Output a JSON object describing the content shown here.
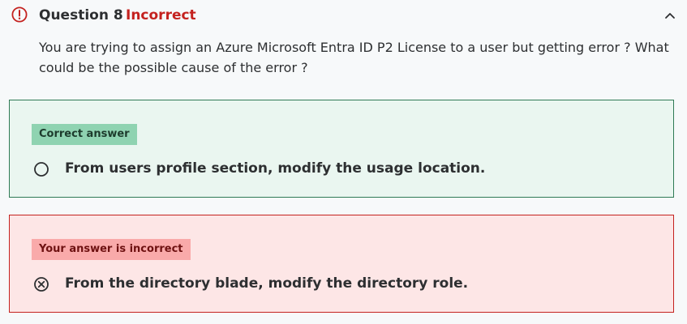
{
  "header": {
    "status_icon": "alert-circle-icon",
    "question_number": "Question 8",
    "status": "Incorrect",
    "collapse_icon": "chevron-up-icon"
  },
  "question": {
    "text": "You are trying to assign an Azure Microsoft Entra ID P2 License to a user but getting error ? What could be the possible cause of the error ?"
  },
  "correct_answer": {
    "badge": "Correct answer",
    "option_icon": "radio-unselected-icon",
    "text": "From users profile section, modify the usage location."
  },
  "your_answer": {
    "badge": "Your answer is incorrect",
    "option_icon": "x-circle-icon",
    "text": "From the directory blade, modify the directory role."
  },
  "colors": {
    "incorrect": "#c4221f",
    "correct_border": "#2f7a55",
    "correct_bg": "#eaf6f0",
    "correct_badge": "#8fd3b1",
    "incorrect_bg": "#fde6e6",
    "incorrect_badge": "#f9aaaa"
  }
}
